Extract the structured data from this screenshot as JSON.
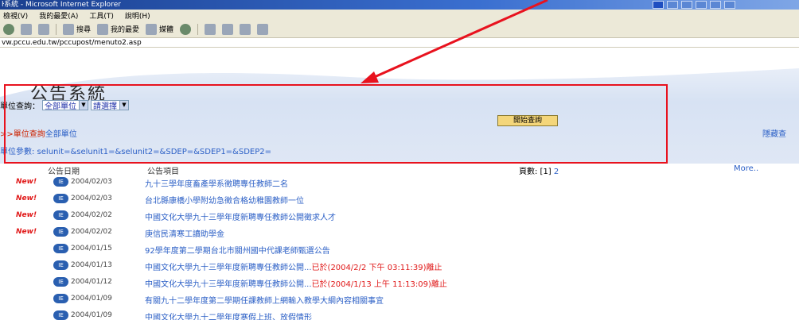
{
  "window": {
    "title": "ŀ系統 - Microsoft Internet Explorer"
  },
  "menubar": {
    "items": [
      "檢視(V)",
      "我的最愛(A)",
      "工具(T)",
      "說明(H)"
    ]
  },
  "toolbar": {
    "search_label": "搜尋",
    "favorites_label": "我的最愛",
    "media_label": "媒體"
  },
  "address": {
    "url": "vw.pccu.edu.tw/pccupost/menuto2.asp"
  },
  "page": {
    "title": "公告系統",
    "unit_query_label": "單位查詢：",
    "unit_select_value": "全部單位",
    "choose_select_value": "請選擇",
    "query_button": "開始查詢",
    "crumb_prefix": ">>單位查詢",
    "crumb_link": "全部單位",
    "hide_link": "隱藏查",
    "param_text": "單位參數: selunit=&selunit1=&selunit2=&SDEP=&SDEP1=&SDEP2="
  },
  "list": {
    "col_date": "公告日期",
    "col_item": "公告項目",
    "pages_label": "頁數: [1]",
    "page_link": "2",
    "more": "More..",
    "new_badge": "New!",
    "ie_badge": "IE",
    "rows": [
      {
        "new": true,
        "date": "2004/02/03",
        "title": "九十三學年度畜產學系徵聘專任教師二名",
        "stop": ""
      },
      {
        "new": true,
        "date": "2004/02/03",
        "title": "台北縣康橋小學附幼急徵合格幼稚園教師一位",
        "stop": ""
      },
      {
        "new": true,
        "date": "2004/02/02",
        "title": "中國文化大學九十三學年度新聘專任教師公開徵求人才",
        "stop": ""
      },
      {
        "new": true,
        "date": "2004/02/02",
        "title": "庚信民清寒工讀助學金",
        "stop": ""
      },
      {
        "new": false,
        "date": "2004/01/15",
        "title": "92學年度第二學期台北市關州國中代課老師甄選公告",
        "stop": ""
      },
      {
        "new": false,
        "date": "2004/01/13",
        "title": "中國文化大學九十三學年度新聘專任教師公開...",
        "stop": "已於(2004/2/2 下午 03:11:39)離止"
      },
      {
        "new": false,
        "date": "2004/01/12",
        "title": "中國文化大學九十三學年度新聘專任教師公開...",
        "stop": "已於(2004/1/13 上午 11:13:09)離止"
      },
      {
        "new": false,
        "date": "2004/01/09",
        "title": "有關九十二學年度第二學期任課教師上網輸入教學大綱內容相關事宜",
        "stop": ""
      },
      {
        "new": false,
        "date": "2004/01/09",
        "title": "中國文化大學九十二學年度寒假上班、放假情形",
        "stop": ""
      }
    ]
  },
  "colors": {
    "highlight": "#e8121e",
    "link": "#2b5fc6",
    "new": "#e01818"
  }
}
